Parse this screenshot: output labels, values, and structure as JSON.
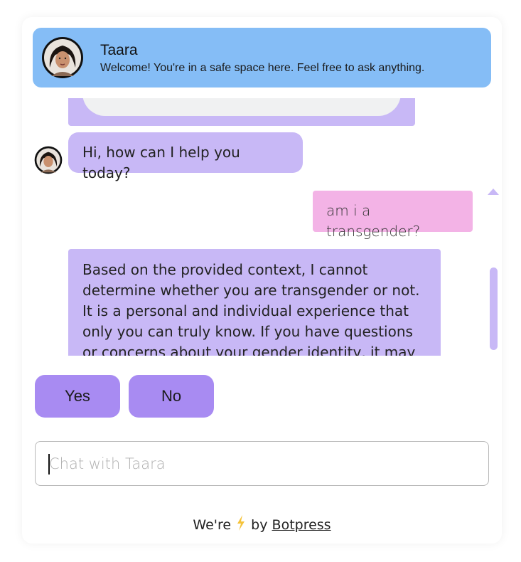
{
  "header": {
    "bot_name": "Taara",
    "bot_description": "Welcome! You're in a safe space here. Feel free to ask anything.",
    "color": "#85bdf6"
  },
  "messages": [
    {
      "sender": "bot",
      "text": "Hi, how can I help you today?"
    },
    {
      "sender": "user",
      "text": "am i a transgender?"
    },
    {
      "sender": "bot",
      "text": "Based on the provided context, I cannot determine whether you are transgender or not. It is a personal and individual experience that only you can truly know. If you have questions or concerns about your gender identity, it may be"
    }
  ],
  "choices": [
    {
      "label": "Yes"
    },
    {
      "label": "No"
    }
  ],
  "composer": {
    "placeholder": "Chat with Taara",
    "value": ""
  },
  "footer": {
    "prefix": "We're",
    "middle": "by",
    "link": "Botpress",
    "icon": "lightning-bolt-icon"
  },
  "colors": {
    "bot_bubble": "#c8b8f6",
    "user_bubble": "#f3b3e6",
    "choice_button": "#a88bf2",
    "bolt": "#f5c33b"
  }
}
